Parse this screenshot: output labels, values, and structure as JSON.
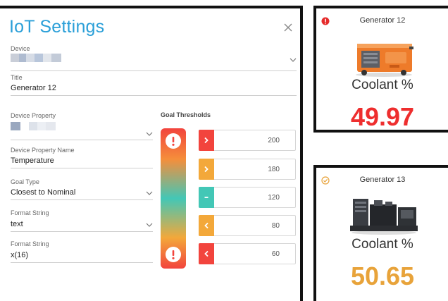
{
  "dialog": {
    "title": "IoT Settings",
    "fields": {
      "device": {
        "label": "Device"
      },
      "title": {
        "label": "Title",
        "value": "Generator 12"
      },
      "device_property": {
        "label": "Device Property"
      },
      "device_property_name": {
        "label": "Device Property Name",
        "value": "Temperature"
      },
      "goal_type": {
        "label": "Goal Type",
        "value": "Closest to Nominal"
      },
      "format_string_1": {
        "label": "Format String",
        "value": "text"
      },
      "format_string_2": {
        "label": "Format String",
        "value": "x(16)"
      }
    },
    "goal_thresholds": {
      "heading": "Goal Thresholds",
      "rows": [
        {
          "value": "200",
          "color": "#f2443d",
          "icon": "chevron-right-icon"
        },
        {
          "value": "180",
          "color": "#f3a83a",
          "icon": "chevron-right-icon"
        },
        {
          "value": "120",
          "color": "#43c7b6",
          "icon": "minus-icon"
        },
        {
          "value": "80",
          "color": "#f3a83a",
          "icon": "chevron-left-icon"
        },
        {
          "value": "60",
          "color": "#f2443d",
          "icon": "chevron-left-icon"
        }
      ],
      "bar_icons": [
        "exclamation-icon",
        "exclamation-icon"
      ]
    }
  },
  "widgets": [
    {
      "title": "Generator 12",
      "metric": "Coolant %",
      "value": "49.97",
      "value_color": "#ee2e2e",
      "status": "alert",
      "status_color": "#e52b2b",
      "status_icon": "alert-circle-icon"
    },
    {
      "title": "Generator 13",
      "metric": "Coolant %",
      "value": "50.65",
      "value_color": "#e8a33a",
      "status": "ok",
      "status_color": "#e8a33a",
      "status_icon": "check-circle-icon"
    }
  ]
}
